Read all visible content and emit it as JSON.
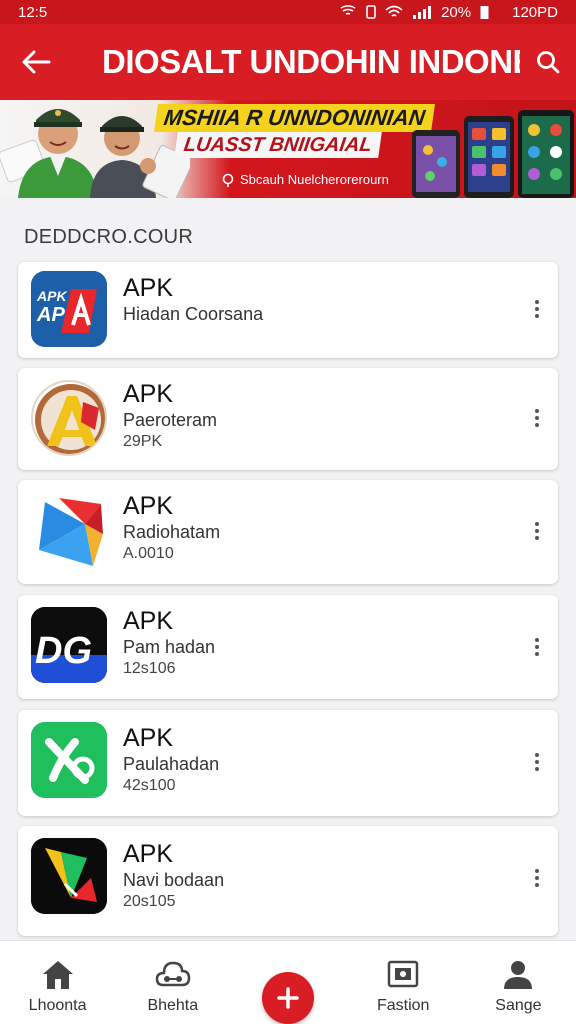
{
  "status_bar": {
    "time": "12:5",
    "battery": "20%",
    "right_text": "120PD"
  },
  "app_bar": {
    "title": "DIOSALT UNDOHIN INDONESI"
  },
  "banner": {
    "headline": "MSHIIA R UNNDONINIAN",
    "subline": "LUASST BNIIGAIAL",
    "caption": "Sbcauh Nuelcherorerourn"
  },
  "section": {
    "title": "DEDDCRO.COUR"
  },
  "apps": [
    {
      "name": "APK",
      "desc": "Hiadan Coorsana",
      "meta": "",
      "icon": "apk-red-blue-icon",
      "icon_text": "APK\nAP"
    },
    {
      "name": "APK",
      "desc": "Paeroteram",
      "meta": "29PK",
      "icon": "brown-circle-a-icon",
      "icon_text": "A"
    },
    {
      "name": "APK",
      "desc": "Radiohatam",
      "meta": "A.0010",
      "icon": "colorful-triangle-icon",
      "icon_text": ""
    },
    {
      "name": "APK",
      "desc": "Pam hadan",
      "meta": "12s106",
      "icon": "dg-logo-icon",
      "icon_text": "DG"
    },
    {
      "name": "APK",
      "desc": "Paulahadan",
      "meta": "42s100",
      "icon": "green-x-icon",
      "icon_text": ""
    },
    {
      "name": "APK",
      "desc": "Navi bodaan",
      "meta": "20s105",
      "icon": "black-arrow-icon",
      "icon_text": ""
    }
  ],
  "bottom_nav": [
    {
      "label": "Lhoonta",
      "icon": "home-icon"
    },
    {
      "label": "Bhehta",
      "icon": "share-icon"
    },
    {
      "label": "",
      "icon": "plus-icon"
    },
    {
      "label": "Fastion",
      "icon": "photo-icon"
    },
    {
      "label": "Sange",
      "icon": "person-icon"
    }
  ],
  "colors": {
    "primary": "#d81e24",
    "accent_yellow": "#f5d21b"
  }
}
